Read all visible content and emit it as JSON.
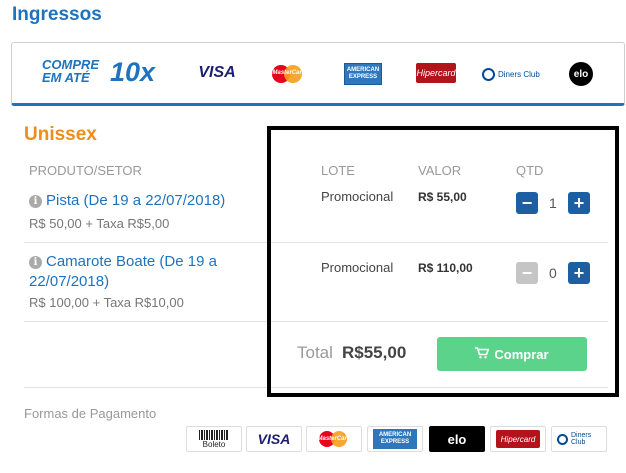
{
  "page_title": "Ingressos",
  "banner": {
    "compre_line1": "COMPRE",
    "compre_line2": "EM ATÉ",
    "compre_big": "10x",
    "brands": {
      "visa": "VISA",
      "mastercard": "MasterCard",
      "amex_line1": "AMERICAN",
      "amex_line2": "EXPRESS",
      "hipercard": "Hipercard",
      "diners": "Diners Club",
      "elo": "elo"
    }
  },
  "section_title": "Unissex",
  "table": {
    "headers": {
      "product": "PRODUTO/SETOR",
      "lote": "LOTE",
      "valor": "VALOR",
      "qtd": "QTD"
    },
    "rows": [
      {
        "name": "Pista (De 19 a 22/07/2018)",
        "price_detail": "R$ 50,00 + Taxa R$5,00",
        "lote": "Promocional",
        "valor": "R$ 55,00",
        "qty": "1"
      },
      {
        "name_line1": "Camarote Boate (De 19 a",
        "name_line2": "22/07/2018)",
        "price_detail": "R$ 100,00 + Taxa R$10,00",
        "lote": "Promocional",
        "valor": "R$ 110,00",
        "qty": "0"
      }
    ]
  },
  "total": {
    "label": "Total",
    "value": "R$55,00"
  },
  "buy_button": "Comprar",
  "payment": {
    "label": "Formas de Pagamento",
    "boleto": "Boleto",
    "visa": "VISA",
    "mastercard": "MasterCard",
    "amex_line1": "AMERICAN",
    "amex_line2": "EXPRESS",
    "elo": "elo",
    "hipercard": "Hipercard",
    "diners": "Diners Club"
  },
  "colors": {
    "primary_blue": "#1e73be",
    "orange": "#f08c1a",
    "buy_green": "#5cd38b",
    "qty_button_blue": "#1c5fa2",
    "qty_button_disabled": "#c5c5c5"
  },
  "icons": {
    "info": "info-circle-icon",
    "minus": "minus-icon",
    "plus": "plus-icon",
    "cart": "shopping-cart-icon"
  }
}
